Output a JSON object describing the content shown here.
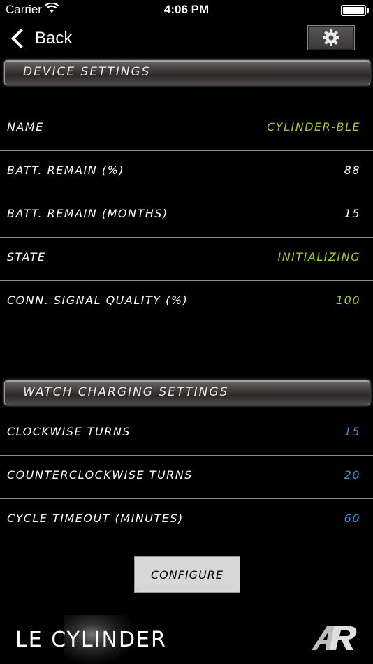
{
  "status_bar": {
    "carrier": "Carrier",
    "time": "4:06 PM"
  },
  "nav": {
    "back_label": "Back"
  },
  "device_settings": {
    "title": "DEVICE SETTINGS",
    "rows": [
      {
        "label": "NAME",
        "value": "CYLINDER-BLE",
        "color": "#a8c43a"
      },
      {
        "label": "BATT. REMAIN (%)",
        "value": "88",
        "color": "#ffffff"
      },
      {
        "label": "BATT. REMAIN (MONTHS)",
        "value": "15",
        "color": "#ffffff"
      },
      {
        "label": "STATE",
        "value": "INITIALIZING",
        "color": "#a8c43a"
      },
      {
        "label": "CONN. SIGNAL QUALITY (%)",
        "value": "100",
        "color": "#a8c43a"
      }
    ]
  },
  "watch_charging_settings": {
    "title": "WATCH CHARGING SETTINGS",
    "rows": [
      {
        "label": "CLOCKWISE TURNS",
        "value": "15",
        "color": "#3a8fd0"
      },
      {
        "label": "COUNTERCLOCKWISE TURNS",
        "value": "20",
        "color": "#3a8fd0"
      },
      {
        "label": "CYCLE TIMEOUT (MINUTES)",
        "value": "60",
        "color": "#3a8fd0"
      }
    ]
  },
  "configure_label": "CONFIGURE",
  "brand": "LE CYLINDER",
  "icons": [
    "back-chevron-icon",
    "gear-icon",
    "wifi-icon",
    "battery-icon",
    "ar-logo-icon"
  ]
}
